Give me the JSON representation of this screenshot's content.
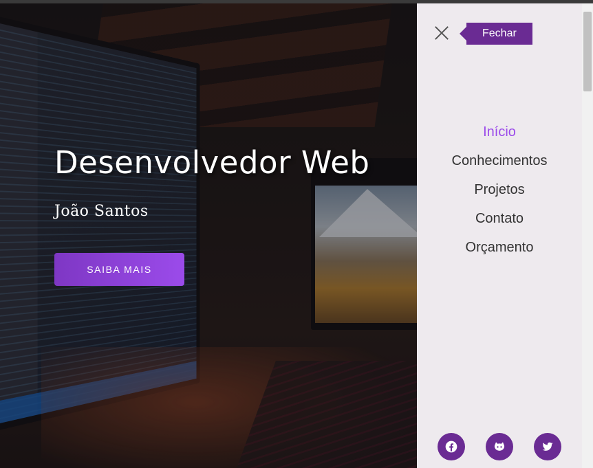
{
  "hero": {
    "title": "Desenvolvedor Web",
    "subtitle": "João Santos",
    "cta_label": "SAIBA MAIS"
  },
  "side_menu": {
    "close_tooltip": "Fechar",
    "items": [
      {
        "label": "Início",
        "active": true
      },
      {
        "label": "Conhecimentos",
        "active": false
      },
      {
        "label": "Projetos",
        "active": false
      },
      {
        "label": "Contato",
        "active": false
      },
      {
        "label": "Orçamento",
        "active": false
      }
    ],
    "social": [
      {
        "icon": "facebook-icon"
      },
      {
        "icon": "github-icon"
      },
      {
        "icon": "twitter-icon"
      }
    ]
  },
  "colors": {
    "accent": "#6a2b93",
    "accent_light": "#9b4bea",
    "menu_bg": "#eeeaee"
  }
}
